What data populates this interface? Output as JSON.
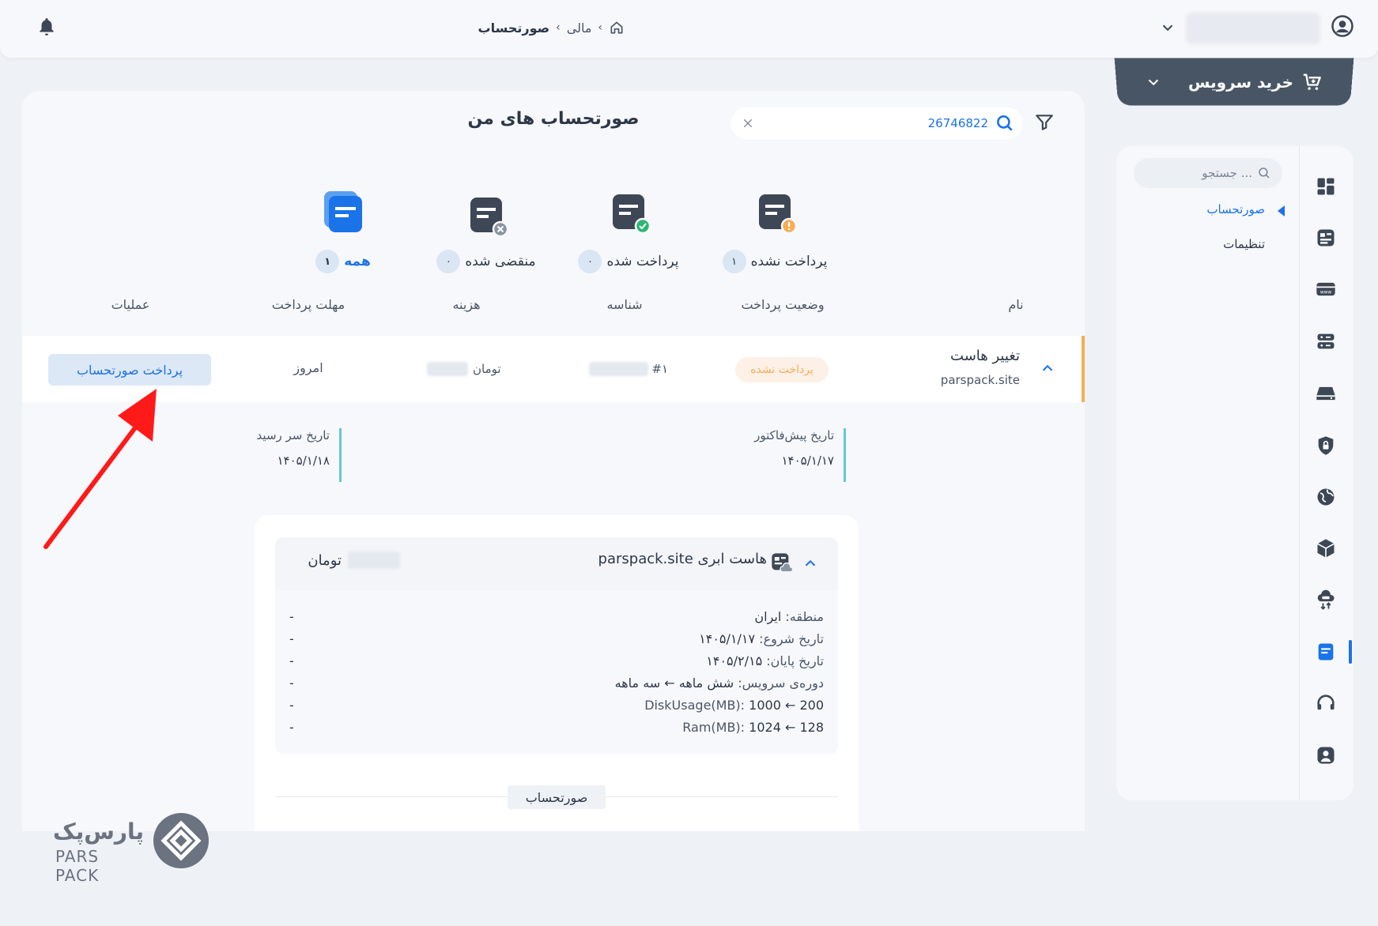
{
  "breadcrumb": {
    "finance": "مالی",
    "current": "صورتحساب"
  },
  "buy_service": {
    "label": "خرید سرویس"
  },
  "sidebar": {
    "search_placeholder": "جستجو ...",
    "items": [
      {
        "label": "صورتحساب",
        "active": true
      },
      {
        "label": "تنظیمات",
        "active": false
      }
    ]
  },
  "page": {
    "title": "صورتحساب های من",
    "search_value": "26746822"
  },
  "tabs": [
    {
      "label": "همه",
      "count": "۱",
      "active": true
    },
    {
      "label": "منقضی شده",
      "count": "۰",
      "active": false
    },
    {
      "label": "پرداخت شده",
      "count": "۰",
      "active": false
    },
    {
      "label": "پرداخت نشده",
      "count": "۱",
      "active": false
    }
  ],
  "table": {
    "headers": {
      "name": "نام",
      "status": "وضعیت پرداخت",
      "id": "شناسه",
      "cost": "هزینه",
      "due": "مهلت پرداخت",
      "actions": "عملیات"
    },
    "row": {
      "name": "تغییر هاست",
      "domain": "parspack.site",
      "status": "پرداخت نشده",
      "id_prefix": "#۱",
      "currency": "تومان",
      "due": "امروز",
      "pay_button": "پرداخت صورتحساب"
    }
  },
  "dates": {
    "proforma_label": "تاریخ پیش‌فاکتور",
    "proforma_value": "۱۴۰۵/۱/۱۷",
    "due_label": "تاریخ سر رسید",
    "due_value": "۱۴۰۵/۱/۱۸"
  },
  "detail": {
    "title": "هاست ابری parspack.site",
    "currency": "تومان",
    "specs": [
      {
        "label": "منطقه:",
        "value": "ایران",
        "price": "-"
      },
      {
        "label": "تاریخ شروع:",
        "value": "۱۴۰۵/۱/۱۷",
        "price": "-"
      },
      {
        "label": "تاریخ پایان:",
        "value": "۱۴۰۵/۲/۱۵",
        "price": "-"
      },
      {
        "label": "دوره‌ی سرویس:",
        "value": "شش ماهه ← سه ماهه",
        "price": "-"
      },
      {
        "label": "DiskUsage(MB):",
        "value": "1000 ← 200",
        "price": "-"
      },
      {
        "label": "Ram(MB):",
        "value": "1024 ← 128",
        "price": "-"
      }
    ],
    "invoice_tab": "صورتحساب"
  },
  "logo": {
    "fa": "پارس‌پک",
    "en": "PARS PACK"
  },
  "colors": {
    "accent": "#1a73e8",
    "warning": "#f6ad55",
    "dark": "#485564",
    "success": "#2bb673"
  }
}
